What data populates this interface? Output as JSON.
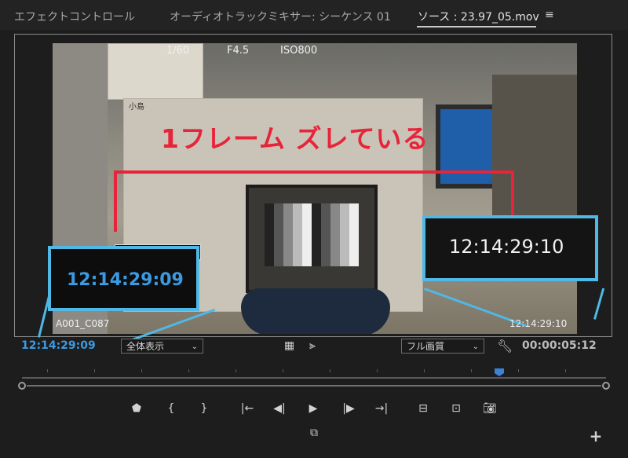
{
  "tabs": [
    {
      "label": "エフェクトコントロール",
      "active": false
    },
    {
      "label": "オーディオトラックミキサー: シーケンス 01",
      "active": false
    },
    {
      "label": "ソース : 23.97_05.mov",
      "active": true
    }
  ],
  "panel_menu_icon": "hamburger-icon",
  "video_overlay": {
    "annotation_text": "1フレーム ズレている",
    "left_timecode": "12:14:29:09",
    "right_timecode": "12:14:29:10",
    "clip_name": "A001_C087",
    "clip_timecode": "12:14:29:10",
    "camera_text_1": "1/60",
    "camera_text_2": "F4.5",
    "camera_text_3": "ISO800",
    "sticker_text": "小島"
  },
  "controls": {
    "playhead_timecode": "12:14:29:09",
    "zoom_select": "全体表示",
    "quality_select": "フル画質",
    "duration_timecode": "00:00:05:12",
    "icons": [
      "film-strip-icon",
      "audio-waveform-icon",
      "wrench-icon"
    ]
  },
  "colors": {
    "accent": "#3b9ae1",
    "annotation": "#e8243a",
    "highlight_box": "#4fb8e4"
  },
  "transport": [
    "add-marker-icon",
    "mark-in-icon",
    "mark-out-icon",
    "go-to-in-icon",
    "step-back-icon",
    "play-icon",
    "step-forward-icon",
    "go-to-out-icon",
    "insert-icon",
    "overwrite-icon",
    "export-frame-icon"
  ],
  "transport_extra": "toggle-proxies-icon",
  "add_button": "+"
}
